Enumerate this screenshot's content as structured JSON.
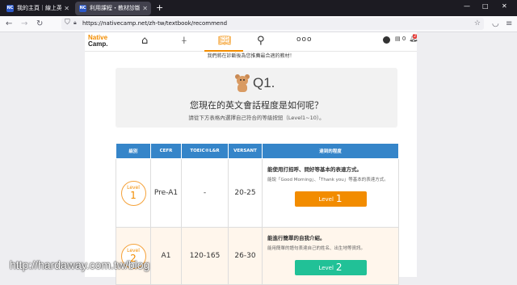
{
  "browser": {
    "tabs": [
      {
        "label": "我的主頁｜線上英語會話就業(N",
        "favicon": "NC"
      },
      {
        "label": "利用課程・教材診斷不再盲選(",
        "favicon": "NC"
      }
    ],
    "new_tab_icon": "plus-icon",
    "url": "https://nativecamp.net/zh-tw/textbook/recommend",
    "window_controls": [
      "—",
      "□",
      "✕"
    ]
  },
  "site": {
    "logo_line1": "Native",
    "logo_line2": "Camp.",
    "nav_icons": [
      "home-icon",
      "teacher-icon",
      "book-icon",
      "search-icon",
      "more-icon"
    ],
    "more_label": "ooo",
    "coin_count": "0",
    "notification_count": "2",
    "accent_color": "#f28c00"
  },
  "intro_text": "我們將在診斷後為您推薦最合適的教材！",
  "question": {
    "number": "Q1.",
    "title": "您現在的英文會話程度是如何呢？",
    "subtitle": "請從下方表格內選擇自己符合的等級按鈕（Level1~10）。"
  },
  "table": {
    "headers": [
      "級別",
      "CEFR",
      "TOEIC®L&R",
      "VERSANT",
      "達到的程度"
    ],
    "header_color": "#3585c9",
    "rows": [
      {
        "level_label": "Level",
        "level_num": "1",
        "cefr": "Pre-A1",
        "toeic": "-",
        "versant": "20-25",
        "desc_title": "能使用打招呼、問好等基本的表達方式。",
        "desc_text": "能說「Good Morning」、「Thank you」等基本的表達方式。",
        "button_label": "Level",
        "button_num": "1",
        "button_color": "#f28c00"
      },
      {
        "level_label": "Level",
        "level_num": "2",
        "cefr": "A1",
        "toeic": "120-165",
        "versant": "26-30",
        "desc_title": "能進行簡單的自我介紹。",
        "desc_text": "能用簡單的語句表達自己的姓名、出生地等資訊。",
        "button_label": "Level",
        "button_num": "2",
        "button_color": "#21c197"
      }
    ]
  },
  "watermark": "http://hardaway.com.tw/blog"
}
